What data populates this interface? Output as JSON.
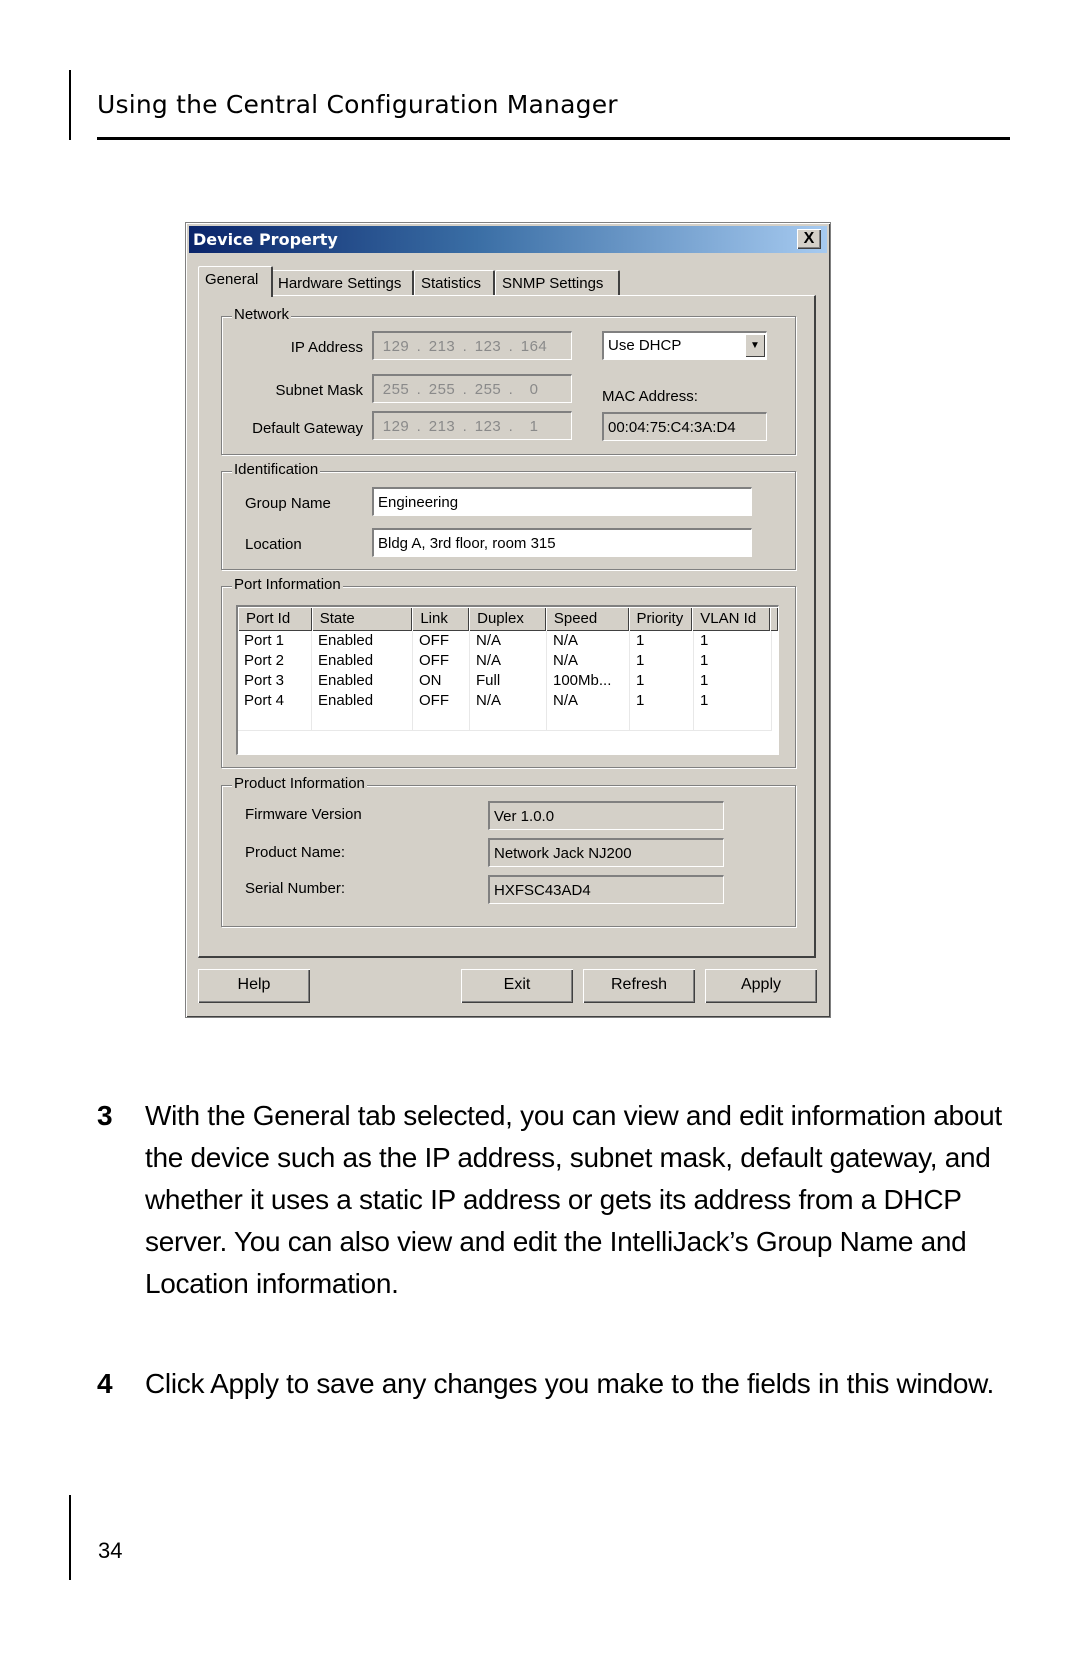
{
  "page": {
    "header_title": "Using the Central Configuration Manager",
    "page_number": "34"
  },
  "dialog": {
    "title": "Device Property",
    "close_label": "X",
    "tabs": [
      {
        "label": "General",
        "active": true
      },
      {
        "label": "Hardware Settings",
        "active": false
      },
      {
        "label": "Statistics",
        "active": false
      },
      {
        "label": "SNMP Settings",
        "active": false
      }
    ],
    "network": {
      "group_label": "Network",
      "ip_label": "IP Address",
      "ip": [
        "129",
        "213",
        "123",
        "164"
      ],
      "subnet_label": "Subnet Mask",
      "subnet": [
        "255",
        "255",
        "255",
        "0"
      ],
      "gateway_label": "Default Gateway",
      "gateway": [
        "129",
        "213",
        "123",
        "1"
      ],
      "ip_mode": "Use DHCP",
      "mac_label": "MAC Address:",
      "mac": "00:04:75:C4:3A:D4"
    },
    "identification": {
      "group_label": "Identification",
      "group_name_label": "Group Name",
      "group_name": "Engineering",
      "location_label": "Location",
      "location": "Bldg A, 3rd floor, room 315"
    },
    "ports": {
      "group_label": "Port Information",
      "columns": [
        "Port Id",
        "State",
        "Link",
        "Duplex",
        "Speed",
        "Priority",
        "VLAN Id"
      ],
      "rows": [
        [
          "Port 1",
          "Enabled",
          "OFF",
          "N/A",
          "N/A",
          "1",
          "1"
        ],
        [
          "Port 2",
          "Enabled",
          "OFF",
          "N/A",
          "N/A",
          "1",
          "1"
        ],
        [
          "Port 3",
          "Enabled",
          "ON",
          "Full",
          "100Mb...",
          "1",
          "1"
        ],
        [
          "Port 4",
          "Enabled",
          "OFF",
          "N/A",
          "N/A",
          "1",
          "1"
        ]
      ]
    },
    "product": {
      "group_label": "Product Information",
      "firmware_label": "Firmware Version",
      "firmware": "Ver 1.0.0",
      "name_label": "Product Name:",
      "name": "Network Jack NJ200",
      "serial_label": "Serial Number:",
      "serial": "HXFSC43AD4"
    },
    "buttons": {
      "help": "Help",
      "exit": "Exit",
      "refresh": "Refresh",
      "apply": "Apply"
    },
    "colors": {
      "titlebar_start": "#0a246a",
      "titlebar_end": "#a6caf0",
      "face": "#d4d0c8"
    }
  },
  "steps": [
    {
      "number": "3",
      "text": "With the General tab selected, you can view and edit information about the device such as the IP address, subnet mask, default gateway, and whether it uses a static IP address or gets its address from a DHCP server. You can also view and edit the IntelliJack’s Group Name and Location information."
    },
    {
      "number": "4",
      "text": "Click Apply to save any changes you make to the fields in this window."
    }
  ]
}
